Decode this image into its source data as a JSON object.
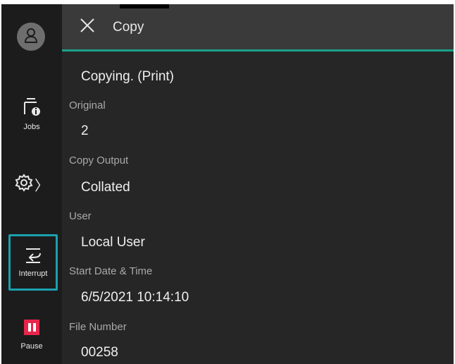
{
  "sidebar": {
    "user_icon": "person-icon",
    "jobs": {
      "icon": "jobs-info-icon",
      "label": "Jobs"
    },
    "settings": {
      "icon": "gear-icon",
      "chevron": "〉"
    },
    "interrupt": {
      "icon": "interrupt-icon",
      "label": "Interrupt"
    },
    "pause": {
      "icon": "pause-icon",
      "label": "Pause"
    }
  },
  "header": {
    "close_icon": "close-icon",
    "title": "Copy"
  },
  "status": "Copying. (Print)",
  "fields": [
    {
      "label": "Original",
      "value": "2"
    },
    {
      "label": "Copy Output",
      "value": "Collated"
    },
    {
      "label": "User",
      "value": "Local User"
    },
    {
      "label": "Start Date & Time",
      "value": "6/5/2021 10:14:10"
    },
    {
      "label": "File Number",
      "value": "00258"
    }
  ],
  "colors": {
    "accent": "#1aa18c",
    "focus_outline": "#1aa1b0",
    "pause": "#e8254b",
    "background": "#262626",
    "header": "#3a3a3a"
  }
}
